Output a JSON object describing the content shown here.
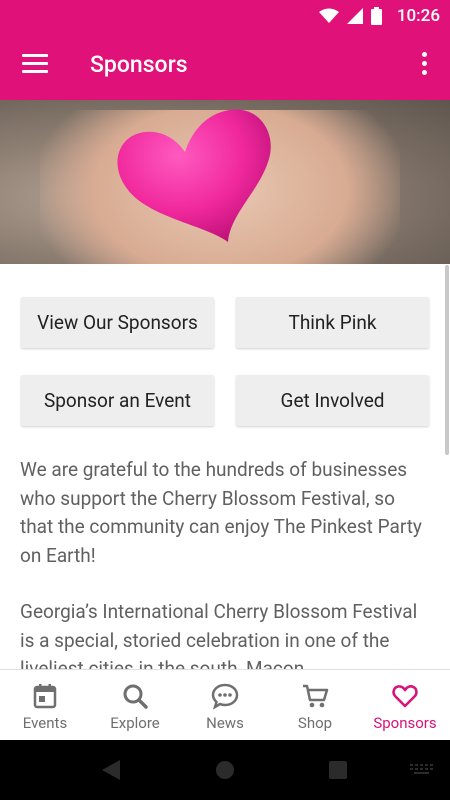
{
  "status_bar": {
    "time": "10:26"
  },
  "app_bar": {
    "title": "Sponsors"
  },
  "buttons": [
    {
      "label": "View Our Sponsors"
    },
    {
      "label": "Think Pink"
    },
    {
      "label": "Sponsor an Event"
    },
    {
      "label": "Get Involved"
    }
  ],
  "body": {
    "paragraph1": "We are grateful to the hundreds of businesses who support the Cherry Blossom Festival, so that the community can enjoy The Pinkest Party on Earth!",
    "paragraph2": "Georgia’s International Cherry Blossom Festival is a special, storied celebration in one of the liveliest cities in the south, Macon"
  },
  "bottom_nav": [
    {
      "label": "Events",
      "icon": "calendar-icon"
    },
    {
      "label": "Explore",
      "icon": "search-icon"
    },
    {
      "label": "News",
      "icon": "chat-icon"
    },
    {
      "label": "Shop",
      "icon": "cart-icon"
    },
    {
      "label": "Sponsors",
      "icon": "heart-icon",
      "active": true
    }
  ],
  "colors": {
    "primary": "#e0127a",
    "active_tab": "#d6137a"
  }
}
